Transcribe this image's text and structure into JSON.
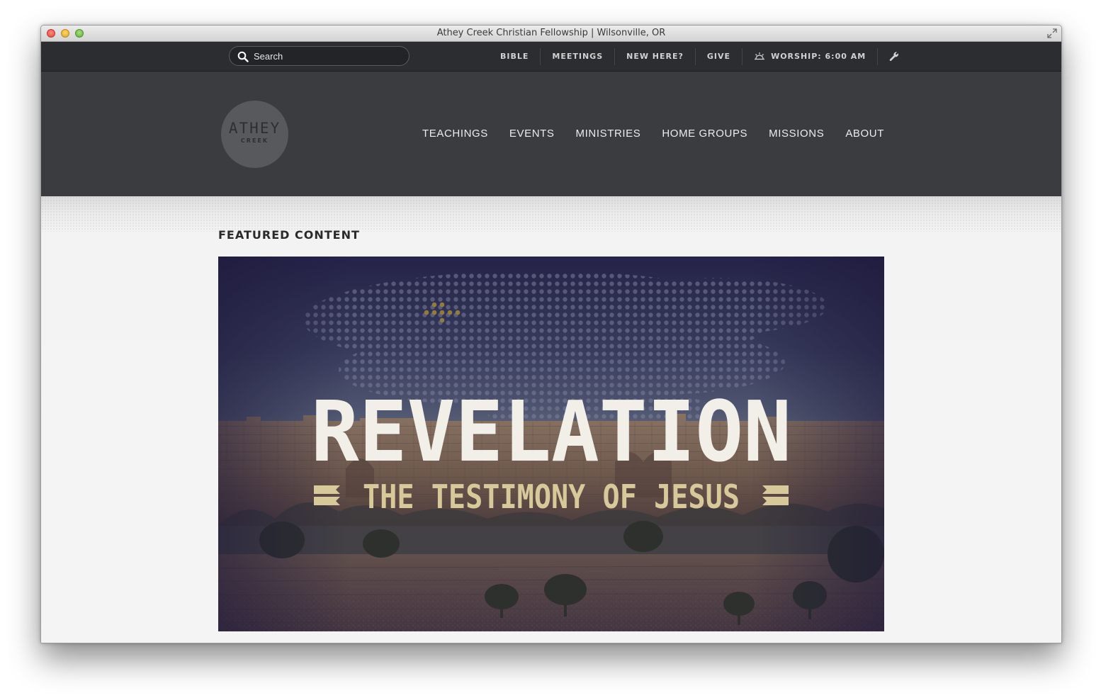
{
  "window": {
    "title": "Athey Creek Christian Fellowship | Wilsonville, OR"
  },
  "utility_bar": {
    "search": {
      "placeholder": "Search",
      "value": ""
    },
    "items": [
      {
        "label": "BIBLE"
      },
      {
        "label": "MEETINGS"
      },
      {
        "label": "NEW HERE?"
      },
      {
        "label": "GIVE"
      },
      {
        "label": "WORSHIP: 6:00 AM",
        "icon": "sun-icon"
      },
      {
        "label": "",
        "icon": "wrench-icon"
      }
    ]
  },
  "header": {
    "logo": {
      "line1": "ATHEY",
      "line2": "CREEK"
    },
    "nav": [
      {
        "label": "TEACHINGS"
      },
      {
        "label": "EVENTS"
      },
      {
        "label": "MINISTRIES"
      },
      {
        "label": "HOME GROUPS"
      },
      {
        "label": "MISSIONS"
      },
      {
        "label": "ABOUT"
      }
    ]
  },
  "featured": {
    "heading": "FEATURED CONTENT",
    "banner": {
      "title": "REVELATION",
      "subtitle": "THE TESTIMONY OF JESUS"
    }
  },
  "colors": {
    "utility_bar_bg": "#2c2d30",
    "header_bg": "#3b3c3f",
    "content_bg": "#f4f4f4",
    "banner_title": "#f2efe8",
    "banner_subtitle": "#d8c99a"
  }
}
